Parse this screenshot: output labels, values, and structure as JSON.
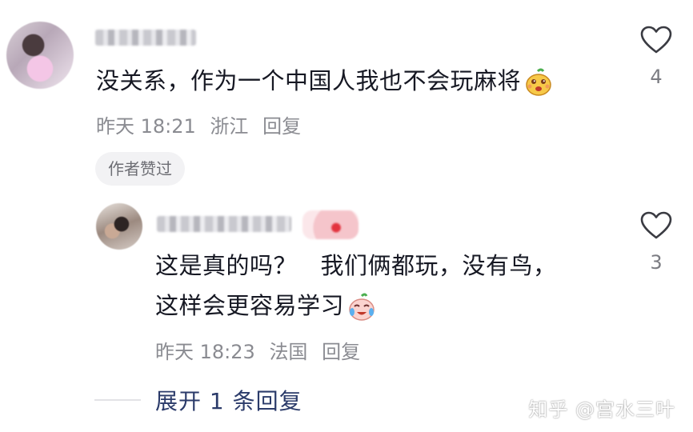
{
  "comments": [
    {
      "text": "没关系，作为一个中国人我也不会玩麻将",
      "emoji": "yellow-face-emoji",
      "time": "昨天 18:21",
      "location": "浙江",
      "reply_label": "回复",
      "author_liked": "作者赞过",
      "likes": "4"
    }
  ],
  "reply": {
    "text_line1": "这是真的吗？　我们俩都玩，没有鸟，",
    "text_line2": "这样会更容易学习",
    "emoji": "crying-laughing-emoji",
    "time": "昨天 18:23",
    "location": "法国",
    "reply_label": "回复",
    "likes": "3"
  },
  "expand_label": "展开 1 条回复",
  "watermark": "知乎 @宫水三叶",
  "colors": {
    "text": "#161823",
    "meta": "#8a8b91",
    "expand": "#2b3b6a"
  }
}
